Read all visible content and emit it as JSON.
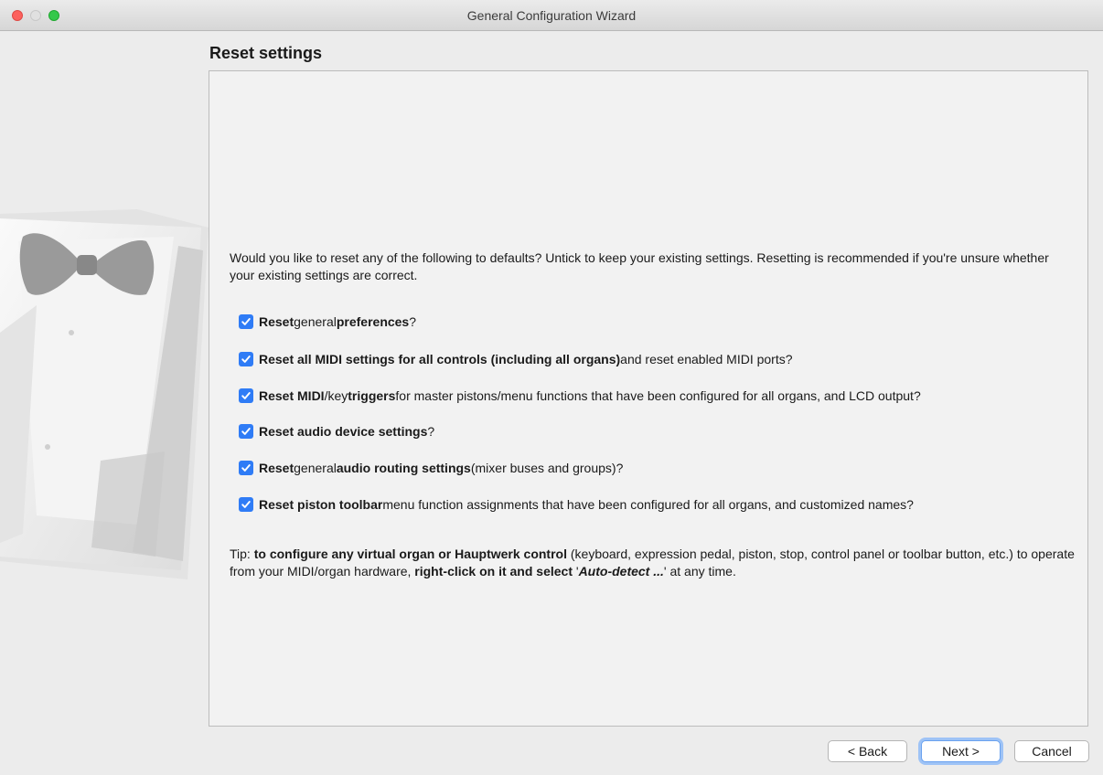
{
  "window": {
    "title": "General Configuration Wizard"
  },
  "page": {
    "title": "Reset settings"
  },
  "intro": "Would you like to reset any of the following to defaults? Untick to keep your existing settings. Resetting is recommended if you're unsure whether your existing settings are correct.",
  "options": [
    {
      "checked": true,
      "parts": [
        {
          "text": "Reset",
          "b": true
        },
        {
          "text": " general "
        },
        {
          "text": "preferences",
          "b": true
        },
        {
          "text": "?"
        }
      ]
    },
    {
      "checked": true,
      "parts": [
        {
          "text": "Reset all MIDI settings for all controls (including all organs)",
          "b": true
        },
        {
          "text": " and reset enabled MIDI ports?"
        }
      ]
    },
    {
      "checked": true,
      "parts": [
        {
          "text": "Reset MIDI",
          "b": true
        },
        {
          "text": "/key "
        },
        {
          "text": "triggers",
          "b": true
        },
        {
          "text": " for master pistons/menu functions that have been configured for all organs, and LCD output?"
        }
      ]
    },
    {
      "checked": true,
      "parts": [
        {
          "text": "Reset audio device settings",
          "b": true
        },
        {
          "text": "?"
        }
      ]
    },
    {
      "checked": true,
      "parts": [
        {
          "text": "Reset",
          "b": true
        },
        {
          "text": " general "
        },
        {
          "text": "audio routing settings",
          "b": true
        },
        {
          "text": " (mixer buses and groups)?"
        }
      ]
    },
    {
      "checked": true,
      "parts": [
        {
          "text": "Reset piston toolbar",
          "b": true
        },
        {
          "text": " menu function assignments that have been configured for all organs, and customized names?"
        }
      ]
    }
  ],
  "tip": {
    "prefix": "Tip: ",
    "bold1": "to configure any virtual organ or Hauptwerk control",
    "mid": " (keyboard, expression pedal, piston, stop, control panel or toolbar button, etc.) to operate from your MIDI/organ hardware, ",
    "bold2": "right-click on it and select",
    "quote_open": " '",
    "italic": "Auto-detect ...",
    "quote_close": "' at any time."
  },
  "buttons": {
    "back": "< Back",
    "next": "Next >",
    "cancel": "Cancel"
  },
  "colors": {
    "checkbox": "#2f7cf6",
    "default_button_glow": "#9ec3f6"
  },
  "icons": {
    "side_art": "tuxedo-bowtie-illustration"
  }
}
